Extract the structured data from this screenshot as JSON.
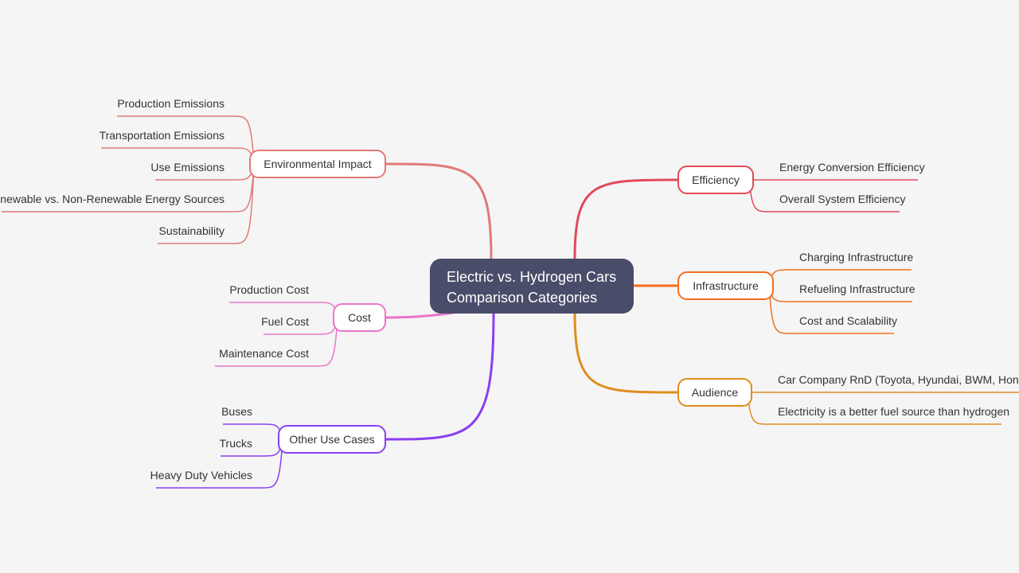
{
  "root": {
    "line1": "Electric vs. Hydrogen Cars",
    "line2": "Comparison Categories",
    "color": "#4a4d6a"
  },
  "branches": [
    {
      "id": "environmental-impact",
      "label": "Environmental Impact",
      "side": "left",
      "color": "#e07a78",
      "children": [
        "Production Emissions",
        "Transportation Emissions",
        "Use Emissions",
        "Renewable vs. Non-Renewable Energy Sources",
        "Sustainability"
      ]
    },
    {
      "id": "cost",
      "label": "Cost",
      "side": "left",
      "color": "#ea76c8",
      "children": [
        "Production Cost",
        "Fuel Cost",
        "Maintenance Cost"
      ]
    },
    {
      "id": "other-use-cases",
      "label": "Other Use Cases",
      "side": "left",
      "color": "#8a3ff0",
      "children": [
        "Buses",
        "Trucks",
        "Heavy Duty Vehicles"
      ]
    },
    {
      "id": "efficiency",
      "label": "Efficiency",
      "side": "right",
      "color": "#e24a5a",
      "children": [
        "Energy Conversion Efficiency",
        "Overall System Efficiency"
      ]
    },
    {
      "id": "infrastructure",
      "label": "Infrastructure",
      "side": "right",
      "color": "#f26e1c",
      "children": [
        "Charging Infrastructure",
        "Refueling Infrastructure",
        "Cost and Scalability"
      ]
    },
    {
      "id": "audience",
      "label": "Audience",
      "side": "right",
      "color": "#e08d1e",
      "children": [
        "Car Company RnD (Toyota, Hyundai, BWM, Honda)",
        "Electricity is a better fuel source than hydrogen"
      ]
    }
  ]
}
